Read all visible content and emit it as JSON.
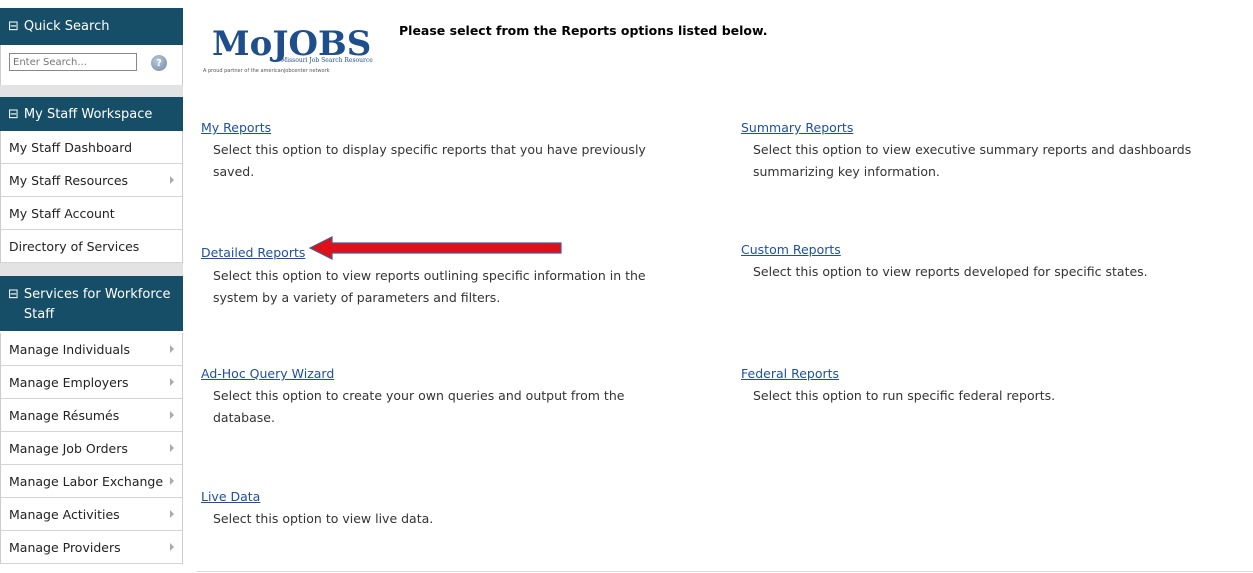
{
  "sidebar": {
    "quick_search": {
      "title": "Quick Search",
      "placeholder": "Enter Search...",
      "help": "?"
    },
    "staff_workspace": {
      "title": "My Staff Workspace",
      "items": [
        {
          "label": "My Staff Dashboard",
          "has_arrow": false
        },
        {
          "label": "My Staff Resources",
          "has_arrow": true
        },
        {
          "label": "My Staff Account",
          "has_arrow": false
        },
        {
          "label": "Directory of Services",
          "has_arrow": false
        }
      ]
    },
    "workforce": {
      "title": "Services for Workforce Staff",
      "items": [
        {
          "label": "Manage Individuals",
          "has_arrow": true
        },
        {
          "label": "Manage Employers",
          "has_arrow": true
        },
        {
          "label": "Manage Résumés",
          "has_arrow": true
        },
        {
          "label": "Manage Job Orders",
          "has_arrow": true
        },
        {
          "label": "Manage Labor Exchange",
          "has_arrow": true
        },
        {
          "label": "Manage Activities",
          "has_arrow": true
        },
        {
          "label": "Manage Providers",
          "has_arrow": true
        }
      ]
    }
  },
  "logo": {
    "main": "MoJOBS",
    "sub": "Missouri Job Search Resource",
    "tagline": "A proud partner of the americanjobcenter network"
  },
  "main": {
    "heading": "Please select from the Reports options listed below.",
    "reports": [
      {
        "id": "my",
        "title": "My Reports",
        "desc": "Select this option to display specific reports that you have previously saved."
      },
      {
        "id": "summary",
        "title": "Summary Reports",
        "desc": "Select this option to view executive summary reports and dashboards summarizing key information."
      },
      {
        "id": "detailed",
        "title": "Detailed Reports",
        "desc": "Select this option to view reports outlining specific information in the system by a variety of parameters and filters."
      },
      {
        "id": "custom",
        "title": "Custom Reports",
        "desc": "Select this option to view reports developed for specific states."
      },
      {
        "id": "adhoc",
        "title": "Ad-Hoc Query Wizard",
        "desc": "Select this option to create your own queries and output from the database."
      },
      {
        "id": "federal",
        "title": "Federal Reports",
        "desc": "Select this option to run specific federal reports."
      },
      {
        "id": "live",
        "title": "Live Data",
        "desc": "Select this option to view live data."
      }
    ]
  },
  "colors": {
    "panel_header": "#154e66",
    "link": "#1f4fa0",
    "annotation_arrow": "#e0101a"
  }
}
